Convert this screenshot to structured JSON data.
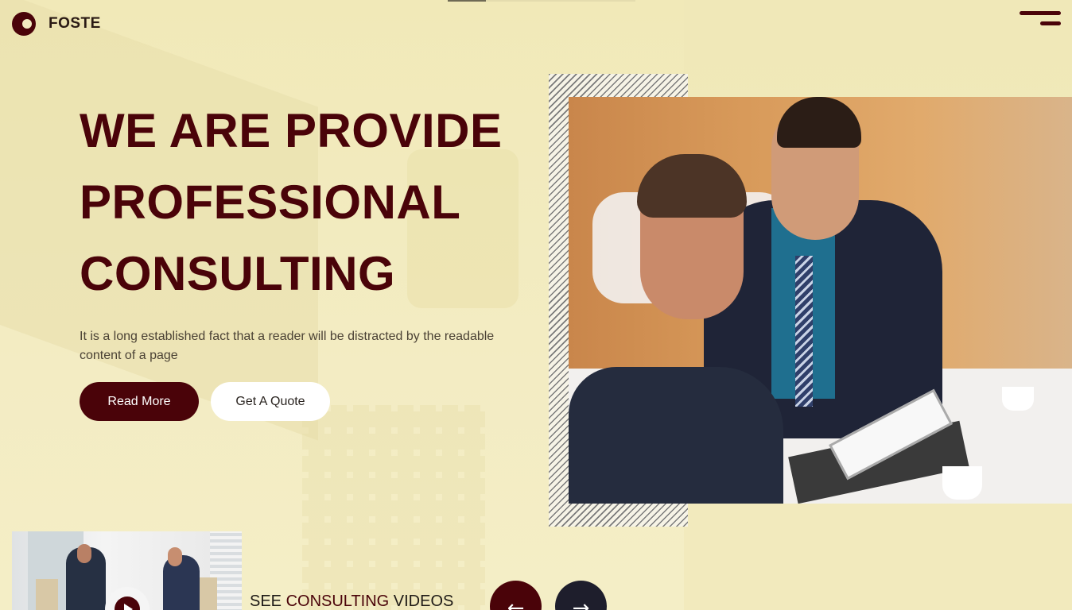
{
  "brand": {
    "name": "FOSTE"
  },
  "hero": {
    "title_lines": [
      "WE ARE PROVIDE",
      "PROFESSIONAL",
      "CONSULTING"
    ],
    "description": "It is a long established fact that a reader will be distracted by the readable content of a page",
    "primary_button": "Read More",
    "secondary_button": "Get A Quote"
  },
  "video": {
    "label_prefix": "SEE ",
    "label_accent": "CONSULTING",
    "label_suffix": " VIDEOS"
  },
  "slider": {
    "prev_arrow": "←",
    "next_arrow": "→"
  },
  "icons": {
    "logo": "logo-icon",
    "menu": "hamburger-menu-icon",
    "play": "play-icon",
    "prev": "arrow-left-icon",
    "next": "arrow-right-icon"
  },
  "colors": {
    "background": "#f2ebc1",
    "primary": "#4a0309",
    "dark": "#1e1e2c",
    "white": "#ffffff"
  }
}
